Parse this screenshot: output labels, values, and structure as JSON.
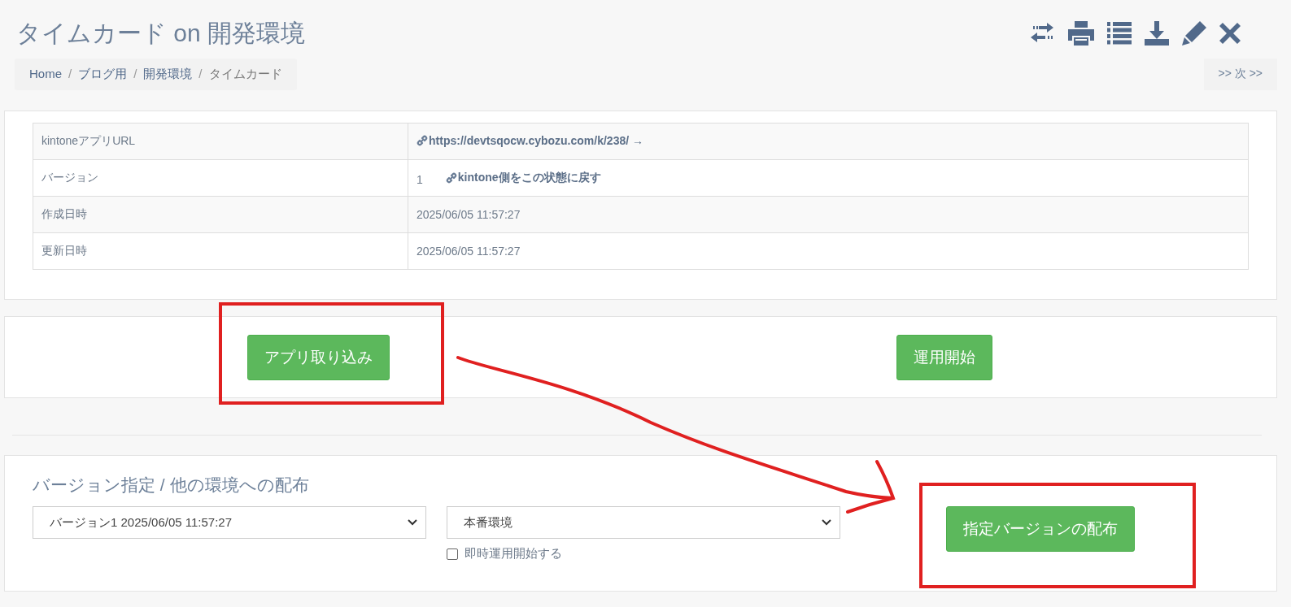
{
  "title": "タイムカード on 開発環境",
  "toolbar": [
    {
      "kind": "swap"
    },
    {
      "kind": "print"
    },
    {
      "kind": "list"
    },
    {
      "kind": "download"
    },
    {
      "kind": "edit"
    },
    {
      "kind": "close"
    }
  ],
  "breadcrumb": [
    {
      "label": "Home",
      "link": true
    },
    {
      "label": "ブログ用",
      "link": true
    },
    {
      "label": "開発環境",
      "link": true
    },
    {
      "label": "タイムカード",
      "link": false
    }
  ],
  "breadcrumb_separator": "/",
  "next_link": ">> 次 >>",
  "info_table": [
    {
      "label": "kintoneアプリURL",
      "cells": [
        {
          "kind": "link",
          "text": "https://devtsqocw.cybozu.com/k/238/ →"
        }
      ]
    },
    {
      "label": "バージョン",
      "cells": [
        {
          "kind": "text",
          "text": "1"
        },
        {
          "kind": "link",
          "text": "kintone側をこの状態に戻す"
        }
      ]
    },
    {
      "label": "作成日時",
      "cells": [
        {
          "kind": "text",
          "text": "2025/06/05 11:57:27"
        }
      ]
    },
    {
      "label": "更新日時",
      "cells": [
        {
          "kind": "text",
          "text": "2025/06/05 11:57:27"
        }
      ]
    }
  ],
  "actions": [
    "アプリ取り込み",
    "運用開始"
  ],
  "deploy": {
    "heading": "バージョン指定 / 他の環境への配布",
    "version_select": "バージョン1 2025/06/05 11:57:27",
    "environment_select": "本番環境",
    "immediate_start": {
      "label": "即時運用開始する",
      "checked": false
    },
    "button": "指定バージョンの配布"
  }
}
